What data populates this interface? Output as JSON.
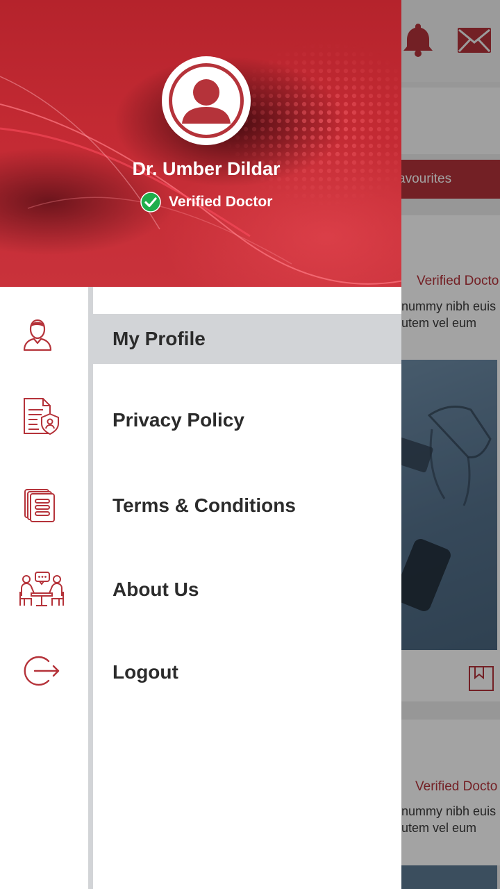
{
  "background": {
    "tab_partial": "avourites",
    "card1": {
      "status": "Verified Docto",
      "line1": "nummy nibh euis",
      "line2": "utem vel eum"
    },
    "card2": {
      "status": "Verified Docto",
      "line1": "nummy nibh euis",
      "line2": "utem vel eum"
    }
  },
  "drawer": {
    "profile": {
      "name": "Dr. Umber Dildar",
      "status": "Verified Doctor"
    },
    "menu": [
      {
        "label": "My Profile",
        "icon": "user-icon",
        "active": true
      },
      {
        "label": "Privacy Policy",
        "icon": "privacy-document-icon",
        "active": false
      },
      {
        "label": "Terms & Conditions",
        "icon": "documents-icon",
        "active": false
      },
      {
        "label": "About Us",
        "icon": "meeting-icon",
        "active": false
      },
      {
        "label": "Logout",
        "icon": "logout-icon",
        "active": false
      }
    ]
  },
  "colors": {
    "brand_red": "#b5333a",
    "active_item_bg": "#d2d4d7",
    "verified_green": "#1fae4b"
  }
}
